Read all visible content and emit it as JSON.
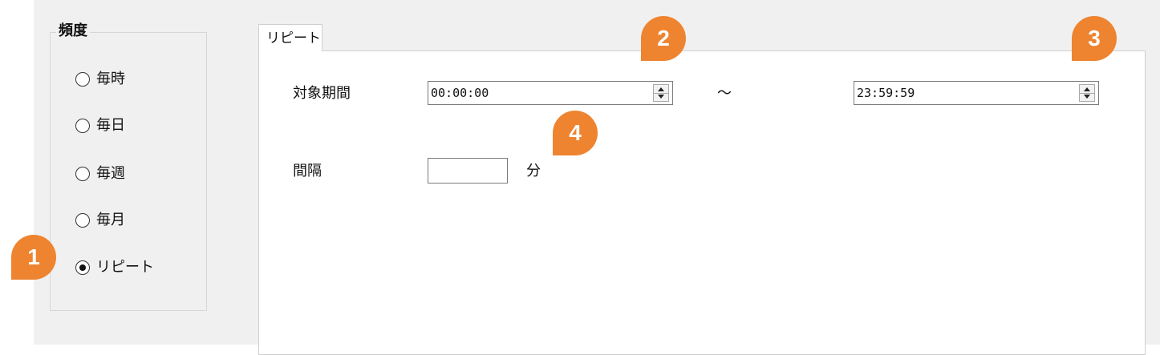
{
  "frequency": {
    "title": "頻度",
    "options": [
      {
        "label": "毎時",
        "checked": false
      },
      {
        "label": "毎日",
        "checked": false
      },
      {
        "label": "毎週",
        "checked": false
      },
      {
        "label": "毎月",
        "checked": false
      },
      {
        "label": "リピート",
        "checked": true
      }
    ]
  },
  "tab": {
    "label": "リピート"
  },
  "period": {
    "label": "対象期間",
    "start": "00:00:00",
    "separator": "～",
    "end": "23:59:59"
  },
  "interval": {
    "label": "間隔",
    "value": "",
    "unit": "分"
  },
  "callouts": [
    "1",
    "2",
    "3",
    "4"
  ],
  "colors": {
    "callout": "#ee8430",
    "panel": "#f0f0f0"
  }
}
